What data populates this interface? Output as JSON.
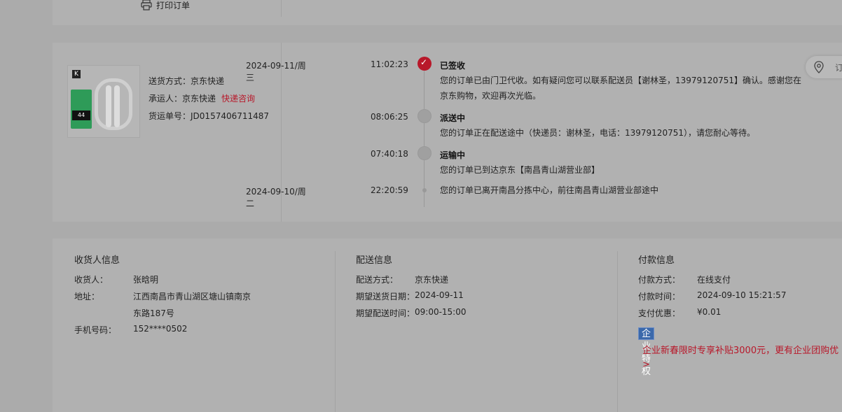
{
  "top": {
    "print_label": "打印订单"
  },
  "shipping": {
    "method_label": "送货方式：",
    "method_value": "京东快递",
    "carrier_label": "承运人：",
    "carrier_value": "京东快递",
    "carrier_link": "快递咨询",
    "waybill_label": "货运单号：",
    "waybill_value": "JD0157406711487",
    "thumb_k": "K",
    "thumb_badge": "44"
  },
  "timeline": [
    {
      "date": "2024-09-11/周三",
      "time": "11:02:23",
      "title": "已签收",
      "desc": "您的订单已由门卫代收。如有疑问您可以联系配送员【谢林圣，13979120751】确认。感谢您在京东购物，欢迎再次光临。"
    },
    {
      "date": "",
      "time": "08:06:25",
      "title": "派送中",
      "desc": "您的订单正在配送途中（快递员：谢林圣，电话：13979120751），请您耐心等待。"
    },
    {
      "date": "",
      "time": "07:40:18",
      "title": "运输中",
      "desc": "您的订单已到达京东【南昌青山湖营业部】"
    },
    {
      "date": "2024-09-10/周二",
      "time": "22:20:59",
      "title": "",
      "desc": "您的订单已离开南昌分拣中心，前往南昌青山湖营业部途中"
    }
  ],
  "map_button_label": "订",
  "receiver": {
    "title": "收货人信息",
    "name_label": "收货人：",
    "name_value": "张晗明",
    "address_label": "地址：",
    "address_line1": "江西南昌市青山湖区塘山镇南京",
    "address_line2": "东路187号",
    "phone_label": "手机号码：",
    "phone_value": "152****0502"
  },
  "delivery": {
    "title": "配送信息",
    "method_label": "配送方式：",
    "method_value": "京东快递",
    "date_label": "期望送货日期：",
    "date_value": "2024-09-11",
    "time_label": "期望配送时间：",
    "time_value": "09:00-15:00"
  },
  "payment": {
    "title": "付款信息",
    "method_label": "付款方式：",
    "method_value": "在线支付",
    "time_label": "付款时间：",
    "time_value": "2024-09-10 15:21:57",
    "discount_label": "支付优惠：",
    "discount_value": "¥0.01",
    "badge": "企业特权",
    "promo_text": "企业新春限时专享补贴3000元，更有企业团购优",
    "promo_arrow": ">"
  },
  "colors": {
    "accent_red": "#b8182a",
    "badge_blue": "#3b69ab",
    "overlay_grey": "#ababab"
  }
}
